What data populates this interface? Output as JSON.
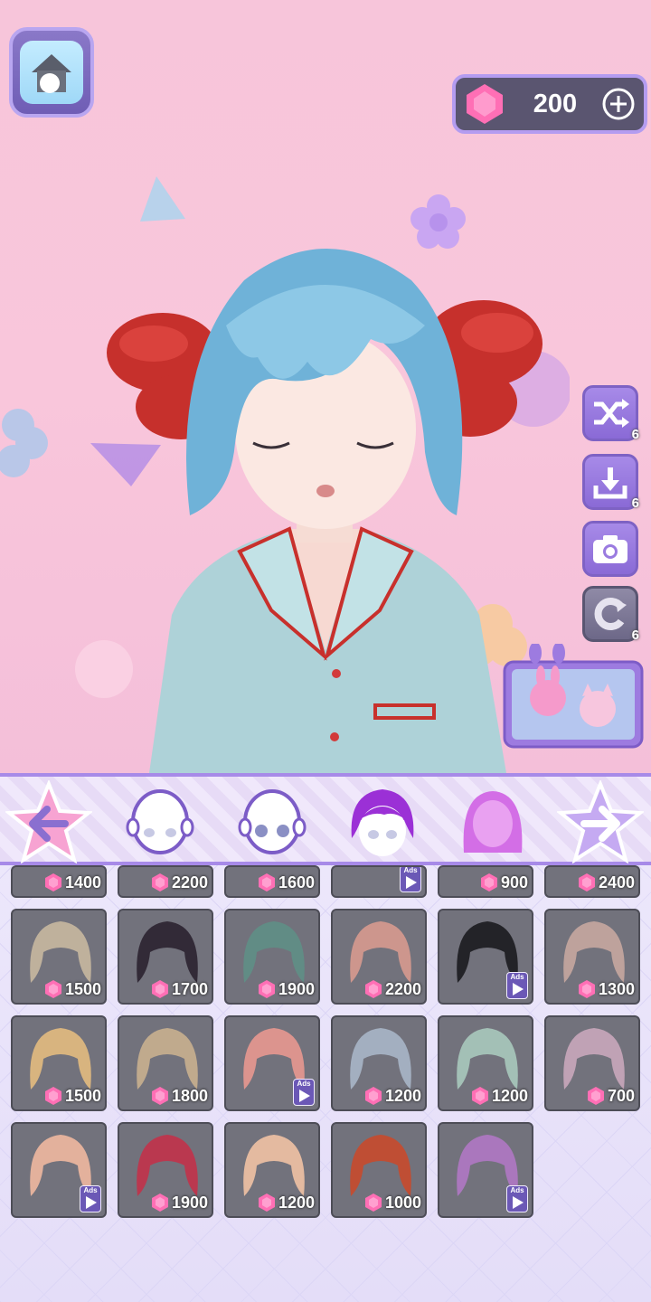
{
  "currency": {
    "gems": "200",
    "add_icon": "plus-circle-icon",
    "gem_icon": "pink-gem-icon"
  },
  "home": {
    "icon": "house-icon"
  },
  "side_actions": [
    {
      "name": "shuffle",
      "icon": "shuffle-icon",
      "count": "6"
    },
    {
      "name": "download",
      "icon": "download-icon",
      "count": "6"
    },
    {
      "name": "camera",
      "icon": "camera-icon",
      "count": ""
    },
    {
      "name": "reset",
      "icon": "reset-icon",
      "count": "6"
    }
  ],
  "promo": {
    "icon": "bunny-cat-promo-icon"
  },
  "tabs": [
    {
      "name": "face",
      "icon": "face-icon",
      "selected": false
    },
    {
      "name": "eyes",
      "icon": "eyes-icon",
      "selected": false
    },
    {
      "name": "front-hair",
      "icon": "front-hair-icon",
      "selected": true
    },
    {
      "name": "back-hair",
      "icon": "back-hair-icon",
      "selected": false
    }
  ],
  "colors": {
    "accent": "#a78ae8",
    "gem": "#ff6fb5",
    "cell_bg": "#72727c"
  },
  "partial_row": [
    {
      "price": "1400"
    },
    {
      "price": "2200"
    },
    {
      "price": "1600"
    },
    {
      "ads": true
    },
    {
      "price": "900"
    },
    {
      "price": "2400"
    }
  ],
  "items": [
    {
      "price": "1500",
      "hair": "#c8b8a0"
    },
    {
      "price": "1700",
      "hair": "#2b2230"
    },
    {
      "price": "1900",
      "hair": "#5f8f86"
    },
    {
      "price": "2200",
      "hair": "#d79a8f"
    },
    {
      "ads": true,
      "hair": "#1b1b1f"
    },
    {
      "price": "1300",
      "hair": "#c7a7a0"
    },
    {
      "price": "1500",
      "hair": "#e3bb80"
    },
    {
      "price": "1800",
      "hair": "#c9b08f"
    },
    {
      "ads": true,
      "hair": "#e89890"
    },
    {
      "price": "1200",
      "hair": "#a9b6c8"
    },
    {
      "price": "1200",
      "hair": "#a8c9bc"
    },
    {
      "price": "700",
      "hair": "#c9a7bb"
    },
    {
      "ads": true,
      "hair": "#f0b8a0"
    },
    {
      "price": "1900",
      "hair": "#c2324a"
    },
    {
      "price": "1200",
      "hair": "#f1c2a4"
    },
    {
      "price": "1000",
      "hair": "#c84a2c"
    },
    {
      "ads": true,
      "hair": "#b078c4"
    }
  ],
  "ads_label": "Ads"
}
